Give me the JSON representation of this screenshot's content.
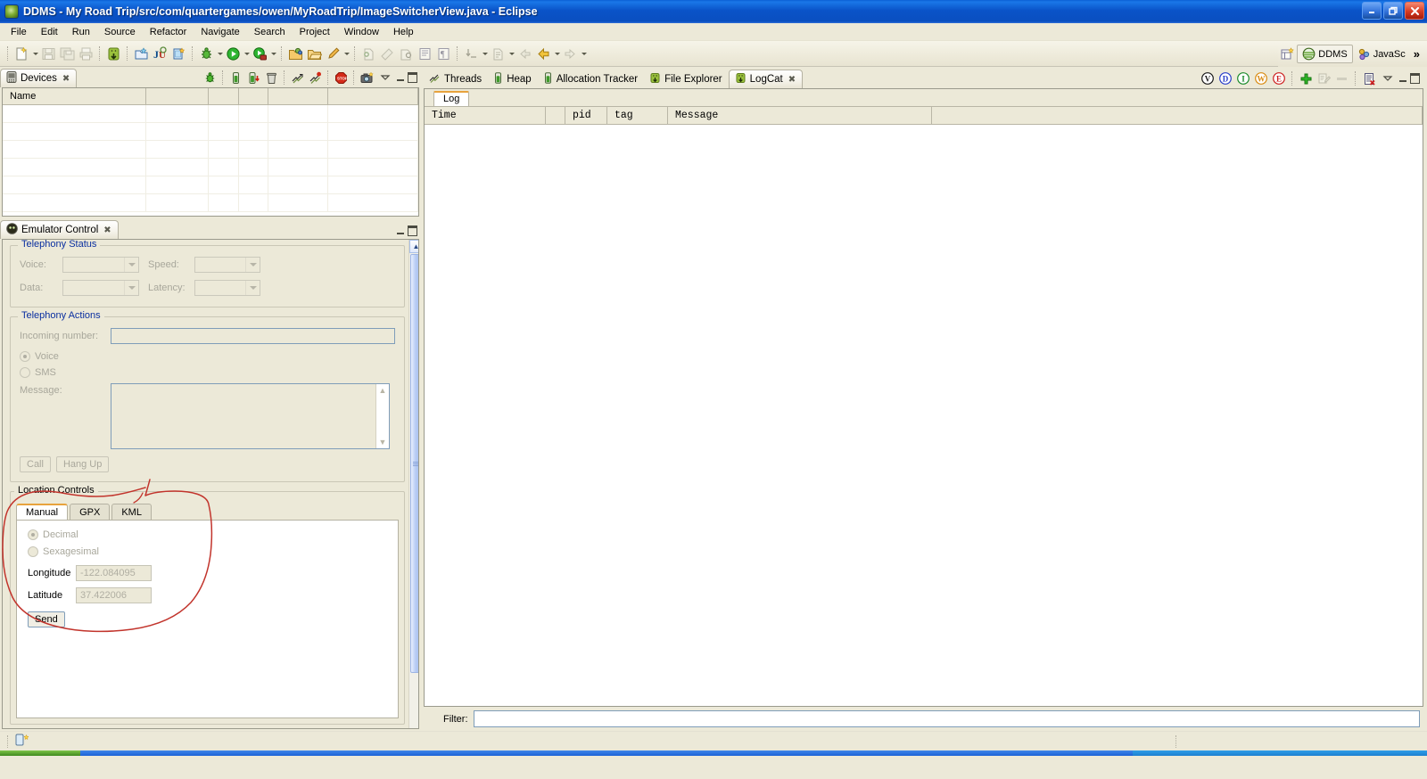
{
  "window": {
    "title": "DDMS - My Road Trip/src/com/quartergames/owen/MyRoadTrip/ImageSwitcherView.java - Eclipse",
    "app_icon": "eclipse-icon",
    "minimize": "_",
    "restore": "❐",
    "close": "✕"
  },
  "menu": {
    "items": [
      {
        "label": "File"
      },
      {
        "label": "Edit"
      },
      {
        "label": "Run"
      },
      {
        "label": "Source"
      },
      {
        "label": "Refactor"
      },
      {
        "label": "Navigate"
      },
      {
        "label": "Search"
      },
      {
        "label": "Project"
      },
      {
        "label": "Window"
      },
      {
        "label": "Help"
      }
    ]
  },
  "toolbar": {
    "groups": [
      {
        "buttons": [
          {
            "icon": "new-file-icon",
            "dropdown": true
          },
          {
            "icon": "save-icon",
            "dropdown": false
          },
          {
            "icon": "save-all-icon",
            "dropdown": false
          },
          {
            "icon": "print-icon",
            "dropdown": false
          }
        ]
      },
      {
        "buttons": [
          {
            "icon": "android-sdk-manager-icon",
            "dropdown": false
          }
        ]
      },
      {
        "buttons": [
          {
            "icon": "new-android-project-icon",
            "dropdown": false
          },
          {
            "icon": "new-junit-test-icon",
            "dropdown": false
          },
          {
            "icon": "new-android-xml-icon",
            "dropdown": false
          }
        ]
      },
      {
        "buttons": [
          {
            "icon": "debug-icon",
            "dropdown": true
          },
          {
            "icon": "run-icon",
            "dropdown": true
          },
          {
            "icon": "external-tools-icon",
            "dropdown": true
          }
        ]
      },
      {
        "buttons": [
          {
            "icon": "open-type-icon",
            "dropdown": false
          },
          {
            "icon": "open-resource-icon",
            "dropdown": false
          },
          {
            "icon": "search-icon",
            "dropdown": true
          }
        ]
      },
      {
        "buttons": [
          {
            "icon": "next-annotation-icon",
            "dropdown": false
          },
          {
            "icon": "previous-annotation-icon",
            "dropdown": false
          },
          {
            "icon": "last-edit-location-icon",
            "dropdown": false
          },
          {
            "icon": "toggle-block-selection-icon",
            "dropdown": false
          },
          {
            "icon": "show-whitespace-icon",
            "dropdown": false
          }
        ]
      },
      {
        "buttons": [
          {
            "icon": "go-to-line-icon",
            "dropdown": true
          },
          {
            "icon": "open-task-icon",
            "dropdown": true
          },
          {
            "icon": "back-icon",
            "dropdown": false
          },
          {
            "icon": "back-history-icon",
            "dropdown": true
          },
          {
            "icon": "forward-icon",
            "dropdown": true
          }
        ]
      }
    ],
    "perspective": {
      "open_perspective_icon": "open-perspective-icon",
      "items": [
        {
          "label": "DDMS",
          "icon": "ddms-perspective-icon",
          "active": true
        },
        {
          "label": "JavaSc",
          "icon": "javascript-perspective-icon",
          "active": false
        }
      ],
      "overflow": "»"
    }
  },
  "devices_view": {
    "tab_label": "Devices",
    "tab_icon": "device-icon",
    "close_icon": "close-icon",
    "toolbar": [
      {
        "icon": "debug-process-icon",
        "name": "debug-selected-process"
      },
      {
        "icon": "update-heap-icon",
        "name": "update-heap"
      },
      {
        "icon": "dump-hprof-icon",
        "name": "dump-hprof-file"
      },
      {
        "icon": "cause-gc-icon",
        "name": "cause-gc"
      },
      {
        "icon": "update-threads-icon",
        "name": "update-threads"
      },
      {
        "icon": "start-method-profiling-icon",
        "name": "start-method-profiling"
      },
      {
        "icon": "stop-process-icon",
        "name": "stop-process"
      },
      {
        "icon": "screen-capture-icon",
        "name": "screen-capture"
      }
    ],
    "view_menu_icon": "view-menu-icon",
    "minimize_icon": "minimize-icon",
    "maximize_icon": "maximize-icon",
    "columns": [
      "Name",
      "",
      "",
      "",
      "",
      ""
    ],
    "rows": []
  },
  "emulator_control": {
    "tab_label": "Emulator Control",
    "tab_icon": "emulator-icon",
    "close_icon": "close-icon",
    "minimize_icon": "minimize-icon",
    "maximize_icon": "maximize-icon",
    "telephony_status": {
      "title": "Telephony Status",
      "fields": [
        {
          "label": "Voice:",
          "value": "",
          "enabled": false
        },
        {
          "label": "Speed:",
          "value": "",
          "enabled": false
        },
        {
          "label": "Data:",
          "value": "",
          "enabled": false
        },
        {
          "label": "Latency:",
          "value": "",
          "enabled": false
        }
      ]
    },
    "telephony_actions": {
      "title": "Telephony Actions",
      "incoming_label": "Incoming number:",
      "incoming_value": "",
      "voice_label": "Voice",
      "voice_selected": true,
      "sms_label": "SMS",
      "sms_selected": false,
      "message_label": "Message:",
      "message_value": "",
      "call_label": "Call",
      "hangup_label": "Hang Up"
    },
    "location_controls": {
      "title": "Location Controls",
      "tabs": [
        {
          "label": "Manual",
          "active": true
        },
        {
          "label": "GPX",
          "active": false
        },
        {
          "label": "KML",
          "active": false
        }
      ],
      "decimal_label": "Decimal",
      "decimal_selected": true,
      "sexagesimal_label": "Sexagesimal",
      "sexagesimal_selected": false,
      "longitude_label": "Longitude",
      "longitude_value": "-122.084095",
      "latitude_label": "Latitude",
      "latitude_value": "37.422006",
      "send_label": "Send"
    },
    "scrollbar": {
      "up_arrow": "▲",
      "down_arrow": "▼"
    }
  },
  "right_panel": {
    "tabs": [
      {
        "label": "Threads",
        "icon": "threads-icon",
        "active": false
      },
      {
        "label": "Heap",
        "icon": "heap-icon",
        "active": false
      },
      {
        "label": "Allocation Tracker",
        "icon": "allocation-tracker-icon",
        "active": false
      },
      {
        "label": "File Explorer",
        "icon": "file-explorer-icon",
        "active": false
      },
      {
        "label": "LogCat",
        "icon": "logcat-icon",
        "active": true
      }
    ],
    "close_icon": "close-icon",
    "toolbar": {
      "level_filters": [
        {
          "label": "V",
          "name": "verbose-filter",
          "color": "#000000"
        },
        {
          "label": "D",
          "name": "debug-filter",
          "color": "#2a3fc9"
        },
        {
          "label": "I",
          "name": "info-filter",
          "color": "#1a8a2a"
        },
        {
          "label": "W",
          "name": "warning-filter",
          "color": "#d98b12"
        },
        {
          "label": "E",
          "name": "error-filter",
          "color": "#cc1f1f"
        }
      ],
      "add_filter_icon": "add-icon",
      "edit_filter_icon": "edit-icon",
      "remove_filter_icon": "remove-icon",
      "clear_log_icon": "clear-log-icon",
      "view_menu_icon": "view-menu-icon",
      "minimize_icon": "minimize-icon",
      "maximize_icon": "maximize-icon"
    },
    "log_tab": "Log",
    "columns": [
      "Time",
      "",
      "pid",
      "tag",
      "Message",
      ""
    ],
    "rows": [],
    "filter_label": "Filter:",
    "filter_value": ""
  },
  "status_bar": {
    "icon": "device-status-icon",
    "text": ""
  },
  "annotation": {
    "color": "#c2342c",
    "shape": "hand-drawn-circle-around-location-controls"
  }
}
